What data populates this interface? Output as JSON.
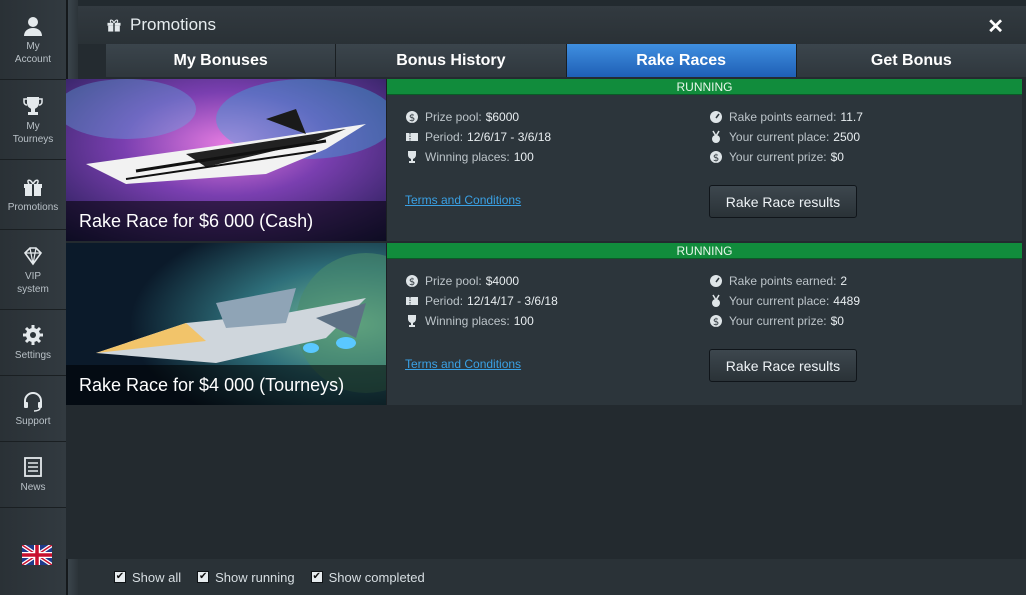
{
  "sidebar": {
    "items": [
      {
        "label_1": "My",
        "label_2": "Account"
      },
      {
        "label_1": "My",
        "label_2": "Tourneys"
      },
      {
        "label_1": "Promotions",
        "label_2": ""
      },
      {
        "label_1": "VIP",
        "label_2": "system"
      },
      {
        "label_1": "Settings",
        "label_2": ""
      },
      {
        "label_1": "Support",
        "label_2": ""
      },
      {
        "label_1": "News",
        "label_2": ""
      }
    ]
  },
  "window": {
    "title": "Promotions",
    "close_glyph": "✕"
  },
  "tabs": [
    {
      "label": "My Bonuses"
    },
    {
      "label": "Bonus History"
    },
    {
      "label": "Rake Races"
    },
    {
      "label": "Get Bonus"
    }
  ],
  "active_tab": "Rake Races",
  "races": [
    {
      "status": "RUNNING",
      "title": "Rake Race for $6 000 (Cash)",
      "prize_pool_label": "Prize pool:",
      "prize_pool": "$6000",
      "period_label": "Period:",
      "period": "12/6/17 - 3/6/18",
      "winning_places_label": "Winning places:",
      "winning_places": "100",
      "points_label": "Rake points earned:",
      "points": "11.7",
      "place_label": "Your current place:",
      "place": "2500",
      "prize_label": "Your current prize:",
      "prize": "$0",
      "terms": "Terms and Conditions",
      "results_button": "Rake Race results"
    },
    {
      "status": "RUNNING",
      "title": "Rake Race for $4 000 (Tourneys)",
      "prize_pool_label": "Prize pool:",
      "prize_pool": "$4000",
      "period_label": "Period:",
      "period": "12/14/17 - 3/6/18",
      "winning_places_label": "Winning places:",
      "winning_places": "100",
      "points_label": "Rake points earned:",
      "points": "2",
      "place_label": "Your current place:",
      "place": "4489",
      "prize_label": "Your current prize:",
      "prize": "$0",
      "terms": "Terms and Conditions",
      "results_button": "Rake Race results"
    }
  ],
  "footer": {
    "show_all": "Show all",
    "show_running": "Show running",
    "show_completed": "Show completed"
  },
  "colors": {
    "active_tab": "#2f78d0",
    "running": "#118c3c",
    "link": "#3aa1e5"
  }
}
